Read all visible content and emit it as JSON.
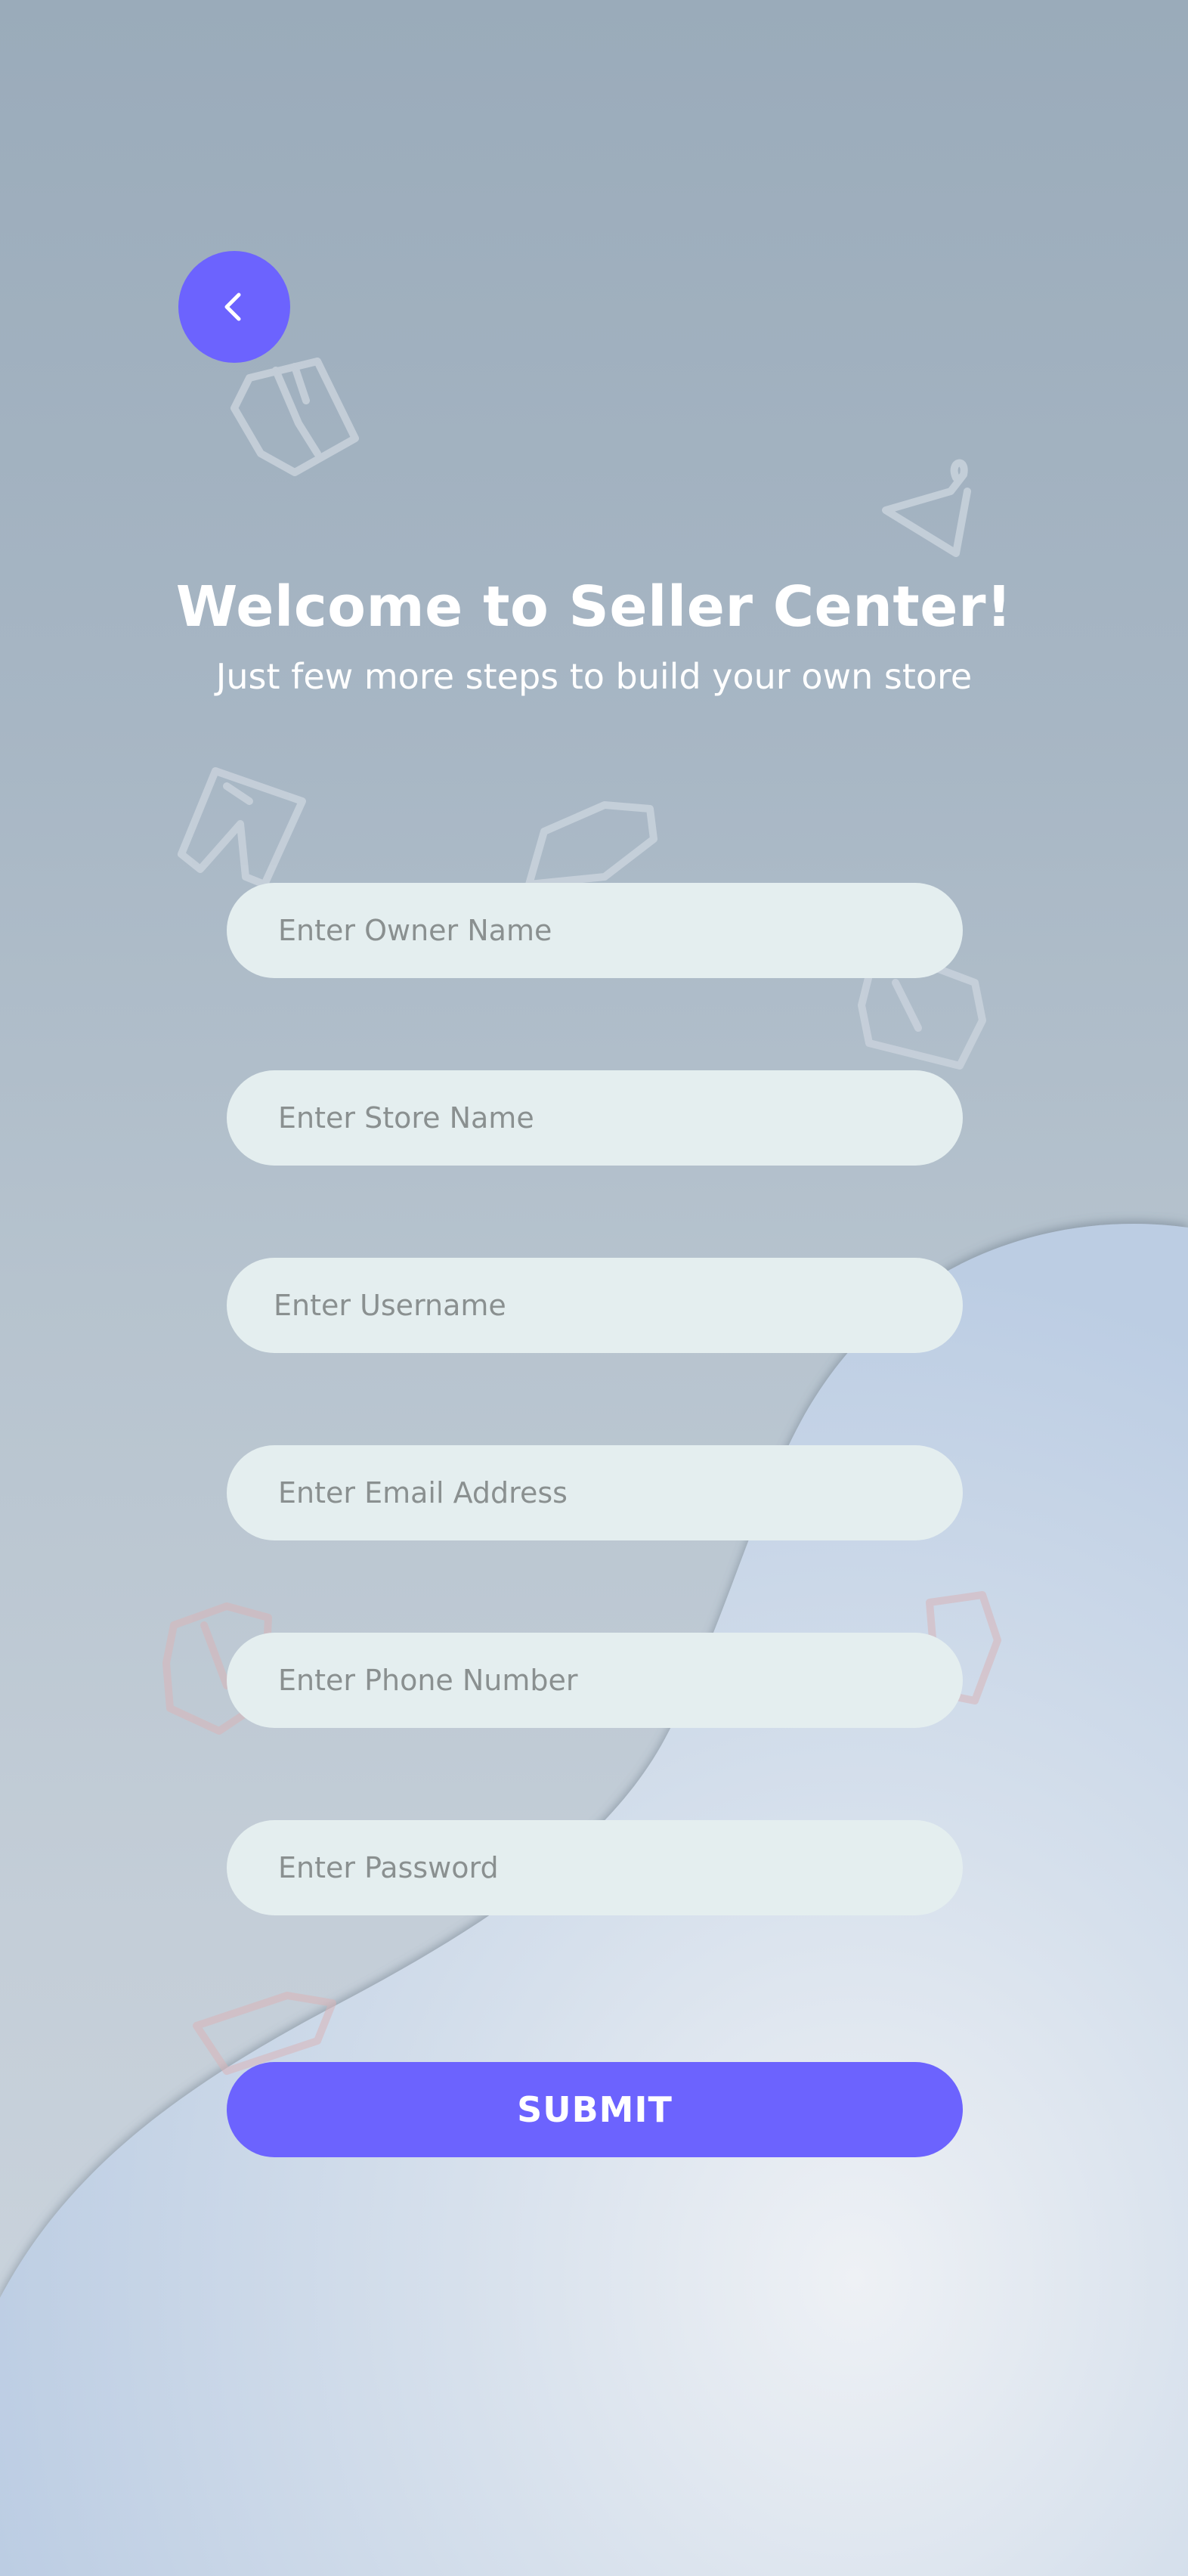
{
  "header": {
    "title": "Welcome to Seller Center!",
    "subtitle": "Just few more steps to build your own store"
  },
  "form": {
    "owner_name_placeholder": "Enter Owner Name",
    "store_name_placeholder": "Enter Store Name",
    "username_placeholder": "Enter Username",
    "email_placeholder": "Enter Email Address",
    "phone_placeholder": "Enter Phone Number",
    "password_placeholder": "Enter Password",
    "submit_label": "SUBMIT"
  },
  "icons": {
    "back": "chevron-left-icon",
    "decorations": [
      "jacket-icon",
      "hanger-icon",
      "pants-icon",
      "shirt-icon",
      "hoodie-icon",
      "tshirt-icon"
    ]
  },
  "colors": {
    "accent": "#6c63fe",
    "field_background": "#e4eeef",
    "title_text": "#ffffff"
  }
}
